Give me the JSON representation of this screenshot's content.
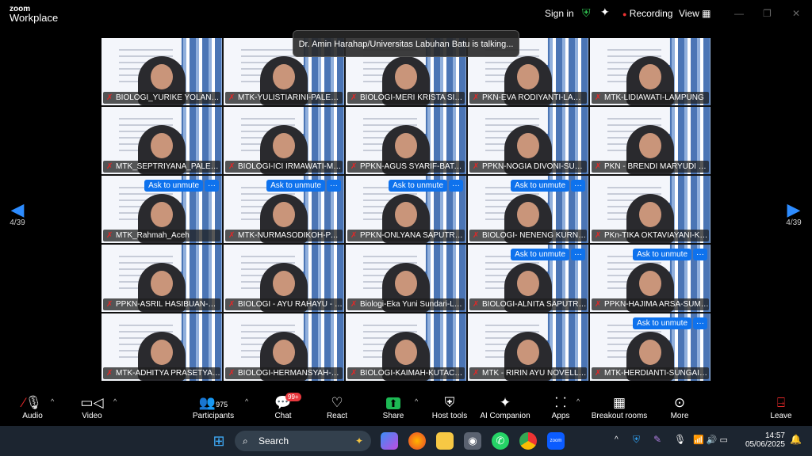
{
  "app": {
    "brand_top": "zoom",
    "brand_bottom": "Workplace",
    "sign_in": "Sign in",
    "recording": "Recording",
    "view": "View"
  },
  "talking": "Dr. Amin Harahap/Universitas Labuhan Batu is talking...",
  "page_indicator": "4/39",
  "ask_label": "Ask to unmute",
  "more_dots": "···",
  "participants": [
    {
      "name": "BIOLOGI_YURIKE YOLANDA_...",
      "ask": false
    },
    {
      "name": "MTK-YULISTIARINI-PALEMB...",
      "ask": false
    },
    {
      "name": "BIOLOGI-MERI KRISTA SITIN...",
      "ask": false
    },
    {
      "name": "PKN-EVA RODIYANTI-LAMP...",
      "ask": false
    },
    {
      "name": "MTK-LIDIAWATI-LAMPUNG",
      "ask": false
    },
    {
      "name": "MTK_SEPTRIYANA_PALEMB...",
      "ask": false
    },
    {
      "name": "BIOLOGI-ICI IRMAWATI-ME...",
      "ask": false
    },
    {
      "name": "PPKN-AGUS SYARIF-BATAM",
      "ask": false
    },
    {
      "name": "PPKN-NOGIA DIVONI-SUM...",
      "ask": false
    },
    {
      "name": "PKN - BRENDI MARYUDI - L...",
      "ask": false
    },
    {
      "name": "MTK_Rahmah_Aceh",
      "ask": true
    },
    {
      "name": "MTK-NURMASODIKOH-PAN...",
      "ask": true
    },
    {
      "name": "PPKN-ONLYANA SAPUTRI D...",
      "ask": true
    },
    {
      "name": "BIOLOGI- NENENG KURNIA ...",
      "ask": true
    },
    {
      "name": "PKn-TIKA OKTAVIAYANI-KAY...",
      "ask": false
    },
    {
      "name": "PPKN-ASRIL HASIBUAN-PA...",
      "ask": false
    },
    {
      "name": "BIOLOGI - AYU RAHAYU - KE...",
      "ask": false
    },
    {
      "name": "Biologi-Eka Yuni Sundari-La...",
      "ask": false
    },
    {
      "name": "BIOLOGI-ALNITA SAPUTRI-B...",
      "ask": true
    },
    {
      "name": "PPKN-HAJIMA ARSA-SUMSEL",
      "ask": true
    },
    {
      "name": "MTK-ADHITYA PRASETYANI...",
      "ask": false
    },
    {
      "name": "BIOLOGI-HERMANSYAH-AC...",
      "ask": false
    },
    {
      "name": "BIOLOGI-KAIMAH-KUTACANE",
      "ask": false
    },
    {
      "name": "MTK - RIRIN AYU NOVELLA ...",
      "ask": false
    },
    {
      "name": "MTK-HERDIANTI-SUNGAI P...",
      "ask": true
    }
  ],
  "toolbar": {
    "audio": "Audio",
    "video": "Video",
    "participants": "Participants",
    "participant_count": "975",
    "chat": "Chat",
    "chat_badge": "99+",
    "react": "React",
    "share": "Share",
    "host_tools": "Host tools",
    "ai_companion": "AI Companion",
    "apps": "Apps",
    "breakout": "Breakout rooms",
    "more": "More",
    "leave": "Leave"
  },
  "taskbar": {
    "search": "Search",
    "time": "14:57",
    "date": "05/06/2025"
  }
}
